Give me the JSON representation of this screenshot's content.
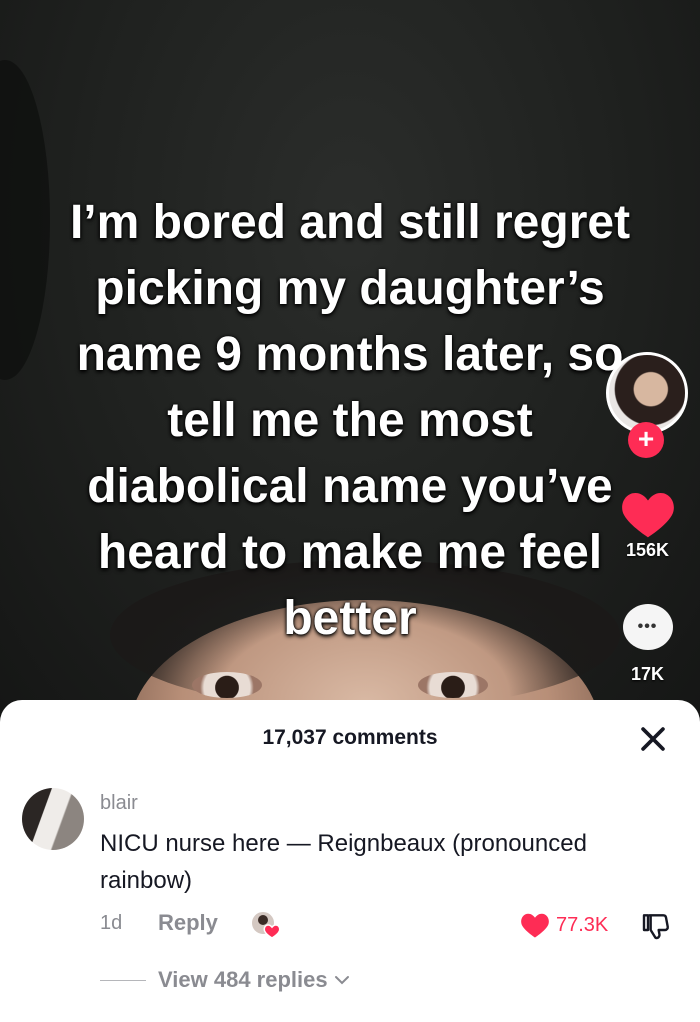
{
  "video": {
    "caption": "I’m bored and still regret picking my daughter’s name 9 months later, so tell me the most diabolical name you’ve heard to make me feel better",
    "likes_count": "156K",
    "comments_count": "17K",
    "follow_symbol": "+",
    "more_symbol": "•••"
  },
  "comments_sheet": {
    "title": "17,037 comments",
    "comment": {
      "username": "blair",
      "text": "NICU nurse here — Reignbeaux (pronounced rainbow)",
      "time": "1d",
      "reply_label": "Reply",
      "like_count": "77.3K",
      "view_replies_label": "View 484 replies"
    }
  },
  "colors": {
    "accent": "#fe2c55",
    "sheet_bg": "#ffffff",
    "muted_text": "#8a8b91"
  },
  "icons": [
    "heart-icon",
    "comment-icon",
    "close-icon",
    "creator-liked-icon",
    "dislike-icon",
    "chevron-down-icon",
    "plus-icon"
  ]
}
